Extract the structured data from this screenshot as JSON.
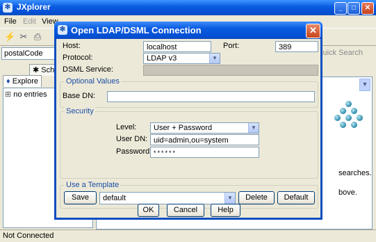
{
  "main": {
    "title": "JXplorer",
    "menu": {
      "file": "File",
      "edit": "Edit",
      "view": "View"
    },
    "search_value": "postalCode",
    "quick_search": "Quick Search",
    "tabs": {
      "schema": "Sch",
      "explore": "Explore"
    },
    "tree_item": "no entries",
    "bg_lines": {
      "searches": "searches.",
      "above": "bove."
    },
    "status": "Not Connected",
    "window_buttons": {
      "minimize": "_",
      "maximize": "□",
      "close": "✕"
    }
  },
  "dialog": {
    "title": "Open LDAP/DSML Connection",
    "close_glyph": "✕",
    "host_label": "Host:",
    "host_value": "localhost",
    "port_label": "Port:",
    "port_value": "389",
    "protocol_label": "Protocol:",
    "protocol_value": "LDAP v3",
    "dsml_label": "DSML Service:",
    "optional": {
      "title": "Optional Values",
      "base_dn_label": "Base DN:",
      "base_dn_value": ""
    },
    "security": {
      "title": "Security",
      "level_label": "Level:",
      "level_value": "User + Password",
      "user_dn_label": "User DN:",
      "user_dn_value": "uid=admin,ou=system",
      "password_label": "Password:",
      "password_value": "******"
    },
    "template": {
      "title": "Use a Template",
      "save": "Save",
      "selected": "default",
      "delete": "Delete",
      "default": "Default"
    },
    "buttons": {
      "ok": "OK",
      "cancel": "Cancel",
      "help": "Help"
    }
  },
  "icons": {
    "app": "jxplorer-logo-icon",
    "connect": "plug-icon",
    "disconnect": "unplug-icon",
    "print": "print-icon",
    "dropdown": "chevron-down-icon"
  }
}
